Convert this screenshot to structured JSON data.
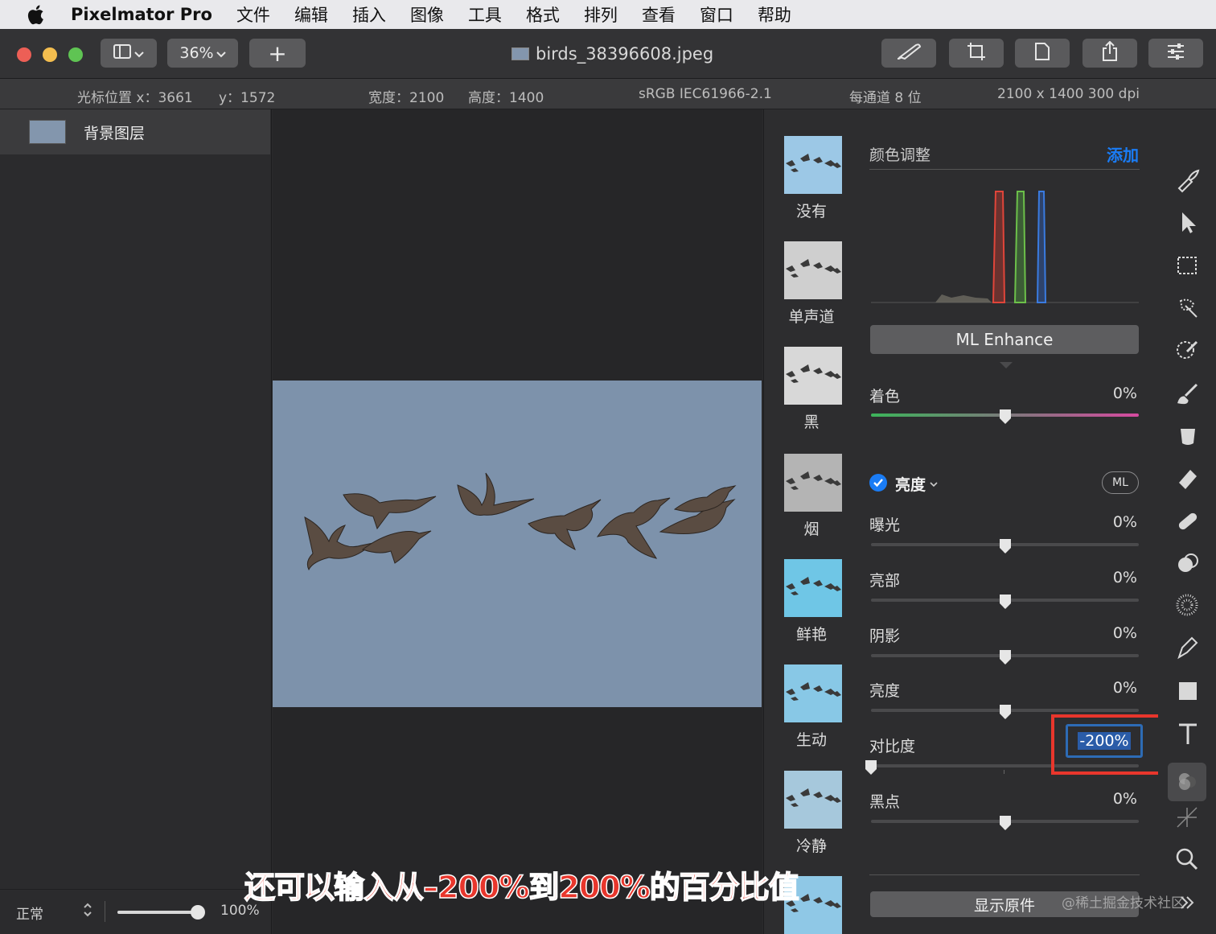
{
  "menubar": {
    "app_name": "Pixelmator Pro",
    "items": [
      "文件",
      "编辑",
      "插入",
      "图像",
      "工具",
      "格式",
      "排列",
      "查看",
      "窗口",
      "帮助"
    ]
  },
  "toolbar": {
    "zoom": "36%",
    "add_label": "+",
    "document_title": "birds_38396608.jpeg",
    "icons": [
      "sidebar-toggle-icon",
      "paintbrush-icon",
      "crop-icon",
      "document-icon",
      "share-icon",
      "sliders-icon"
    ]
  },
  "info": {
    "cursor_x": "光标位置 x：3661",
    "cursor_y": "y：1572",
    "width": "宽度：2100",
    "height": "高度：1400",
    "colorspace": "sRGB IEC61966-2.1",
    "bit_depth": "每通道 8 位",
    "dimensions": "2100 x 1400 300 dpi"
  },
  "layers": {
    "items": [
      {
        "name": "背景图层"
      }
    ],
    "blend_mode": "正常",
    "opacity": "100%",
    "opacity_value": 1.0
  },
  "presets": [
    {
      "label": "没有",
      "tone": "#9cc8e6"
    },
    {
      "label": "单声道",
      "tone": "#cfcfcf"
    },
    {
      "label": "黑",
      "tone": "#d8d8d8"
    },
    {
      "label": "烟",
      "tone": "#b4b4b4"
    },
    {
      "label": "鲜艳",
      "tone": "#6fc6e6"
    },
    {
      "label": "生动",
      "tone": "#88c8e6"
    },
    {
      "label": "冷静",
      "tone": "#a6c8dc"
    },
    {
      "label": "",
      "tone": "#8fc8e6"
    }
  ],
  "adjustments": {
    "header": "颜色调整",
    "add_label": "添加",
    "ml_enhance": "ML Enhance",
    "tint": {
      "label": "着色",
      "value": "0%",
      "level": 0.5
    },
    "light_section": "亮度",
    "ml_badge": "ML",
    "sliders": [
      {
        "label": "曝光",
        "value": "0%",
        "level": 0.5
      },
      {
        "label": "亮部",
        "value": "0%",
        "level": 0.5
      },
      {
        "label": "阴影",
        "value": "0%",
        "level": 0.5
      },
      {
        "label": "亮度",
        "value": "0%",
        "level": 0.5
      },
      {
        "label": "对比度",
        "value": "-200%",
        "level": 0.0
      },
      {
        "label": "黑点",
        "value": "0%",
        "level": 0.5
      }
    ],
    "show_original": "显示原件"
  },
  "tools": [
    "brush-style-icon",
    "arrange-pointer-icon",
    "marquee-select-icon",
    "quick-select-icon",
    "color-select-icon",
    "paint-icon",
    "fill-bucket-icon",
    "erase-icon",
    "retouch-icon",
    "effects-icon",
    "pixel-fill-icon",
    "pen-icon",
    "shape-icon",
    "text-icon",
    "color-adjust-icon",
    "effects-sparkle-icon",
    "zoom-icon"
  ],
  "caption": "还可以输入从–200%到200%的百分比值",
  "watermark": "@稀土掘金技术社区",
  "accent": "#1a7cf5",
  "highlight": "#e8362c"
}
